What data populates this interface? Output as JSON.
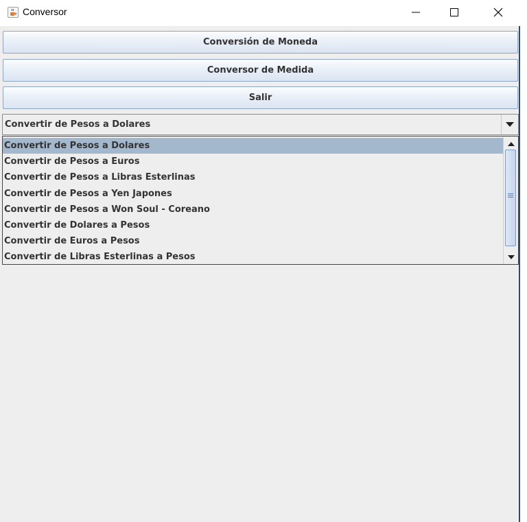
{
  "window": {
    "title": "Conversor",
    "app_icon": "java-coffee-icon",
    "controls": [
      "minimize-icon",
      "maximize-icon",
      "close-icon"
    ]
  },
  "buttons": {
    "currency": "Conversión de Moneda",
    "measure": "Conversor de Medida",
    "exit": "Salir"
  },
  "combo": {
    "selected": "Convertir de Pesos a Dolares",
    "options": [
      "Convertir de Pesos a Dolares",
      "Convertir de Pesos a Euros",
      "Convertir de Pesos a Libras Esterlinas",
      "Convertir de Pesos a Yen Japones",
      "Convertir de Pesos a Won Soul - Coreano",
      "Convertir de Dolares a Pesos",
      "Convertir de Euros a Pesos",
      "Convertir de Libras Esterlinas a Pesos"
    ],
    "highlighted_index": 0
  },
  "colors": {
    "selection": "#a3b8cc",
    "button_border": "#8ea4c5",
    "background": "#eeeeee"
  }
}
